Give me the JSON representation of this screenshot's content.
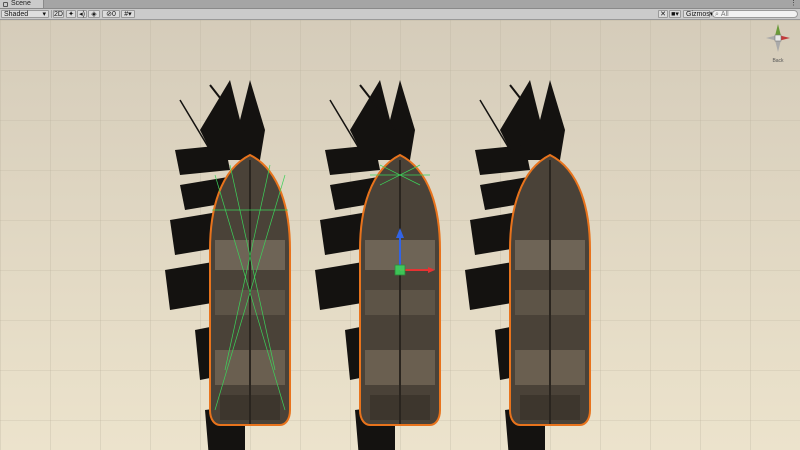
{
  "tab": {
    "label": "Scene"
  },
  "toolbar": {
    "draw_mode": "Shaded",
    "mode_2d": "2D",
    "gizmos": "Gizmos",
    "search_placeholder": "All",
    "hidden_count": "0"
  },
  "gizmo": {
    "view_label": "Back"
  },
  "colors": {
    "selection_outline": "#e8731c",
    "collider": "#3cd25a",
    "axis_y": "#3264e6",
    "axis_x": "#e63232",
    "background": "#e2d8c0"
  },
  "icons": [
    "scene-tab-icon",
    "light-toggle-icon",
    "audio-toggle-icon",
    "effects-icon",
    "hidden-objects-icon",
    "camera-icon",
    "tools-icon",
    "scene-gizmo-icon"
  ]
}
